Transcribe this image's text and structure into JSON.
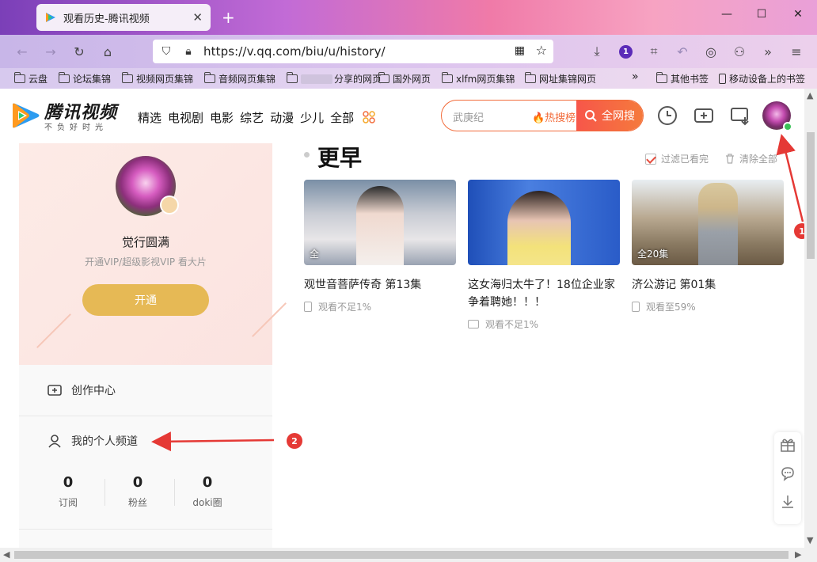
{
  "browser": {
    "tab_title": "观看历史-腾讯视频",
    "url": "https://v.qq.com/biu/u/history/",
    "extension_badge": "1"
  },
  "bookmarks": [
    {
      "label": "云盘"
    },
    {
      "label": "论坛集锦"
    },
    {
      "label": "视频网页集锦"
    },
    {
      "label": "音频网页集锦"
    },
    {
      "label": "分享的网页"
    },
    {
      "label": "国外网页"
    },
    {
      "label": "xlfm网页集锦"
    },
    {
      "label": "网址集锦网页"
    },
    {
      "label": "其他书签"
    },
    {
      "label": "移动设备上的书签"
    }
  ],
  "site": {
    "logo_text": "腾讯视频",
    "slogan": "不负好时光",
    "nav": [
      "精选",
      "电视剧",
      "电影",
      "综艺",
      "动漫",
      "少儿",
      "全部"
    ],
    "search_placeholder": "武庚纪",
    "hot_label": "🔥热搜榜",
    "search_button": "全网搜"
  },
  "profile": {
    "name": "觉行圆满",
    "subtitle": "开通VIP/超级影视VIP 看大片",
    "open_button": "开通",
    "menu": {
      "creator": "创作中心",
      "channel": "我的个人频道"
    },
    "stats": [
      {
        "num": "0",
        "label": "订阅"
      },
      {
        "num": "0",
        "label": "粉丝"
      },
      {
        "num": "0",
        "label": "doki圈"
      }
    ]
  },
  "history": {
    "section_title": "更早",
    "filter_label": "过滤已看完",
    "clear_label": "清除全部",
    "items": [
      {
        "title": "观世音菩萨传奇 第13集",
        "progress": "观看不足1%",
        "episodes": "全",
        "device": "phone"
      },
      {
        "title": "这女海归太牛了！18位企业家争着聘她！！！",
        "progress": "观看不足1%",
        "episodes": "",
        "device": "tv"
      },
      {
        "title": "济公游记 第01集",
        "progress": "观看至59%",
        "episodes": "全20集",
        "device": "phone"
      }
    ]
  },
  "annotations": [
    "1",
    "2"
  ],
  "colors": {
    "accent": "#f26b3a",
    "vip_gold": "#e6b955",
    "annotation": "#e53935"
  }
}
